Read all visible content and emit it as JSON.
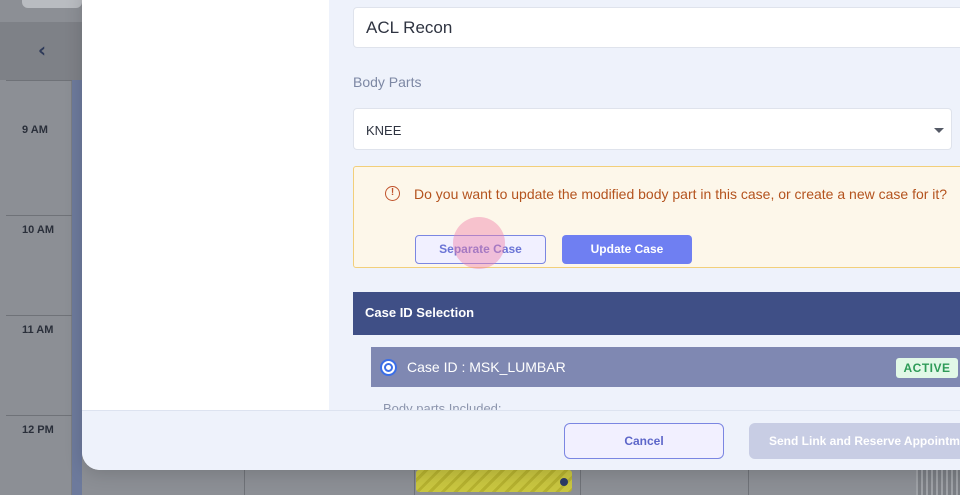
{
  "background": {
    "times": [
      "9 AM",
      "10 AM",
      "11 AM",
      "12 PM"
    ]
  },
  "form": {
    "procedure_value": "ACL Recon",
    "body_parts_label": "Body Parts",
    "body_parts_value": "KNEE"
  },
  "warning": {
    "message": "Do you want to update the modified body part in this case, or create a new case for it?",
    "separate_label": "Separate Case",
    "update_label": "Update Case"
  },
  "case_selection": {
    "header": "Case ID Selection",
    "items": [
      {
        "case_id": "Case ID : MSK_LUMBAR",
        "status": "ACTIVE",
        "sub": "Body parts Included:"
      }
    ]
  },
  "footer": {
    "cancel_label": "Cancel",
    "send_label": "Send Link and Reserve Appointment"
  },
  "colors": {
    "primary": "#6f7ff2",
    "case_header": "#3f4f86",
    "warning_text": "#b4531e",
    "active_badge": "#2e9b58"
  }
}
